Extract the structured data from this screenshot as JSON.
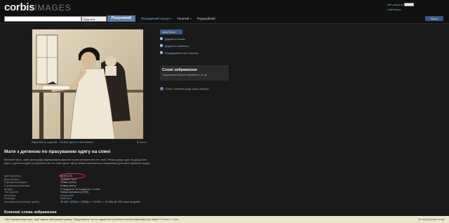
{
  "header": {
    "logo": "corbis",
    "logo_sub": "IMAGES",
    "search": {
      "placeholder": "",
      "category": "Будь-яка категорія",
      "button": "Пошуковий"
    },
    "nav": [
      "Розширений пошук",
      "Творчий",
      "Редакційний"
    ],
    "account": {
      "line1": "Мій рахунок",
      "line2": "Лайтбокси",
      "cart": "Візок"
    }
  },
  "image": {
    "caption": "Right-click to copy link · Corbis | Open in new window",
    "zoom_label": "Чисто"
  },
  "title": "Мати з дитиною по прасуванню одягу на спині",
  "description": "Вінтажне фото, яким фотографи відтворювали звичний прояв материнства тих часів. Жінка прасує одяг на дошці біля вікна, а дитина сидить у перев'язі в неї на спині. Дата і автор знімка залишаються невідомими для цього архівного кадру.",
  "metadata": [
    {
      "k": "Ідентифікатор",
      "v": "BE001234",
      "link": false
    },
    {
      "k": "Дата Знімок:",
      "v": "Травень 1921",
      "link": false
    },
    {
      "k": "З дозволом моделі:",
      "v": "Немає релізу",
      "link": false
    },
    {
      "k": "З дозволом власника:",
      "v": "Немає релізу",
      "link": false
    },
    {
      "k": "Кредит:",
      "v": "© Андерсон та Андерсон / Corbis",
      "link": false
    },
    {
      "k": "Тип ліцензії:",
      "v": "Права керованого (RM)",
      "link": false
    },
    {
      "k": "Категорія:",
      "v": "Історичний",
      "link": true
    },
    {
      "k": "Колекція:",
      "v": "Bettmann",
      "link": true
    },
    {
      "k": "Максимальний розмір файлу:",
      "v": "36 MB / 4002px × 3205px × 13.00in. × 10.00in @ 300 точок на дюйм",
      "link": false
    }
  ],
  "subheading": "Ключові слова зображення",
  "sidebar": {
    "price_button": "Ціна Фото",
    "links": [
      "Додати в кошик",
      "Додати в лайтбокс",
      "Роздрукувати цю сторінку"
    ],
    "similar_title": "Схожі зображення",
    "similar_sub": "Подивитися більше зображень, як це",
    "question": "У Вас є питання щодо цього образу?"
  },
  "cookies": {
    "text": "Сайт використовує куки, щоб надати вам кращий досвід. Продовжуючи, ви погоджуєтеся прийняти політику відповідно до нашої",
    "link": "Політика Cookie.",
    "close": "Не відображати знову"
  },
  "colors": {
    "accent": "#5a7ea6",
    "highlight_circle": "#e0256a",
    "cookie_bg": "#eae6c8"
  }
}
